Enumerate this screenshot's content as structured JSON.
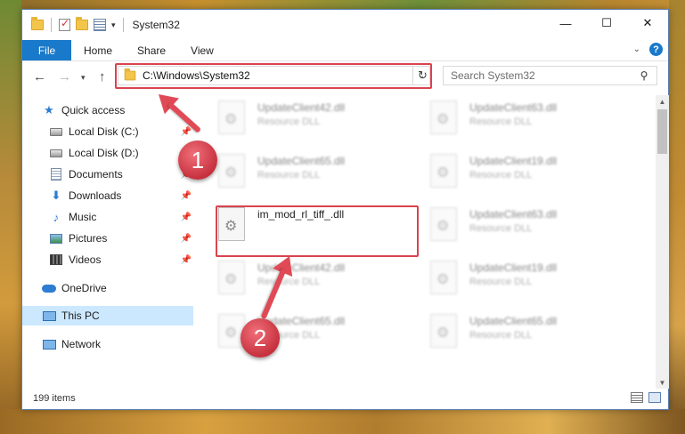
{
  "window": {
    "title": "System32",
    "controls": {
      "minimize": "—",
      "maximize": "☐",
      "close": "✕"
    }
  },
  "ribbon": {
    "tabs": [
      "File",
      "Home",
      "Share",
      "View"
    ],
    "help": "?",
    "collapse": "⌄"
  },
  "address_bar": {
    "path": "C:\\Windows\\System32",
    "search_placeholder": "Search System32"
  },
  "nav_pane": {
    "quick_access": "Quick access",
    "items": [
      {
        "label": "Local Disk (C:)",
        "pinned": true
      },
      {
        "label": "Local Disk (D:)",
        "pinned": false
      },
      {
        "label": "Documents",
        "pinned": true
      },
      {
        "label": "Downloads",
        "pinned": true
      },
      {
        "label": "Music",
        "pinned": true
      },
      {
        "label": "Pictures",
        "pinned": true
      },
      {
        "label": "Videos",
        "pinned": true
      }
    ],
    "onedrive": "OneDrive",
    "this_pc": "This PC",
    "network": "Network"
  },
  "files": {
    "left": [
      {
        "name": "UpdateClient42.dll",
        "type": "Resource DLL"
      },
      {
        "name": "UpdateClient65.dll",
        "type": "Resource DLL"
      },
      {
        "name": "im_mod_rl_tiff_.dll",
        "type": ""
      },
      {
        "name": "UpdateClient42.dll",
        "type": "Resource DLL"
      },
      {
        "name": "UpdateClient65.dll",
        "type": "Resource DLL"
      }
    ],
    "right": [
      {
        "name": "UpdateClient63.dll",
        "type": "Resource DLL"
      },
      {
        "name": "UpdateClient19.dll",
        "type": "Resource DLL"
      },
      {
        "name": "UpdateClient63.dll",
        "type": "Resource DLL"
      },
      {
        "name": "UpdateClient19.dll",
        "type": "Resource DLL"
      },
      {
        "name": "UpdateClient65.dll",
        "type": "Resource DLL"
      }
    ]
  },
  "status_bar": {
    "item_count": "199 items"
  },
  "annotations": {
    "step1": "1",
    "step2": "2"
  },
  "colors": {
    "accent": "#1979ca",
    "selection": "#cce8ff",
    "annotation": "#e04a56"
  }
}
